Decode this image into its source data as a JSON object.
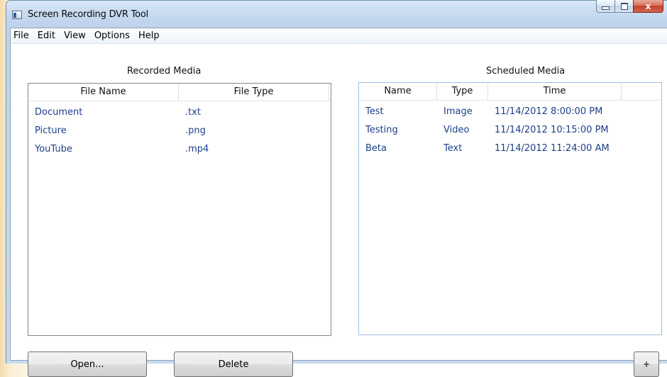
{
  "window": {
    "title": "Screen Recording DVR Tool",
    "caption": {
      "minimize": "–",
      "maximize": "□",
      "close": "x"
    }
  },
  "menu": [
    "File",
    "Edit",
    "View",
    "Options",
    "Help"
  ],
  "recorded": {
    "label": "Recorded Media",
    "columns": [
      "File Name",
      "File Type"
    ],
    "rows": [
      [
        "Document",
        ".txt"
      ],
      [
        "Picture",
        ".png"
      ],
      [
        "YouTube",
        ".mp4"
      ]
    ]
  },
  "scheduled": {
    "label": "Scheduled Media",
    "columns": [
      "Name",
      "Type",
      "Time"
    ],
    "rows": [
      [
        "Test",
        "Image",
        "11/14/2012 8:00:00 PM"
      ],
      [
        "Testing",
        "Video",
        "11/14/2012 10:15:00 PM"
      ],
      [
        "Beta",
        "Text",
        "11/14/2012 11:24:00 AM"
      ]
    ]
  },
  "buttons": {
    "open": "Open...",
    "delete": "Delete",
    "add": "+"
  },
  "colors": {
    "row_text": "#1d3f8a",
    "close_red": "#c2412b",
    "list_border_focus": "#9cc0e4"
  }
}
